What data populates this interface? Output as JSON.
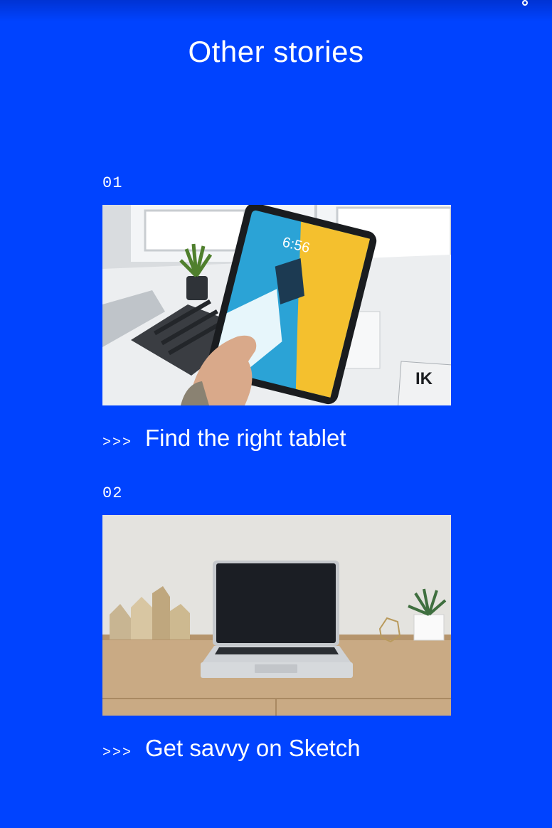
{
  "section": {
    "title": "Other stories"
  },
  "header": {
    "share_icon": "share-icon"
  },
  "colors": {
    "background": "#0043ff",
    "text": "#ffffff"
  },
  "stories": [
    {
      "number": "01",
      "chevrons": ">>>",
      "title": "Find the right tablet",
      "image": "tablet-photo"
    },
    {
      "number": "02",
      "chevrons": ">>>",
      "title": "Get savvy on Sketch",
      "image": "laptop-photo"
    }
  ]
}
